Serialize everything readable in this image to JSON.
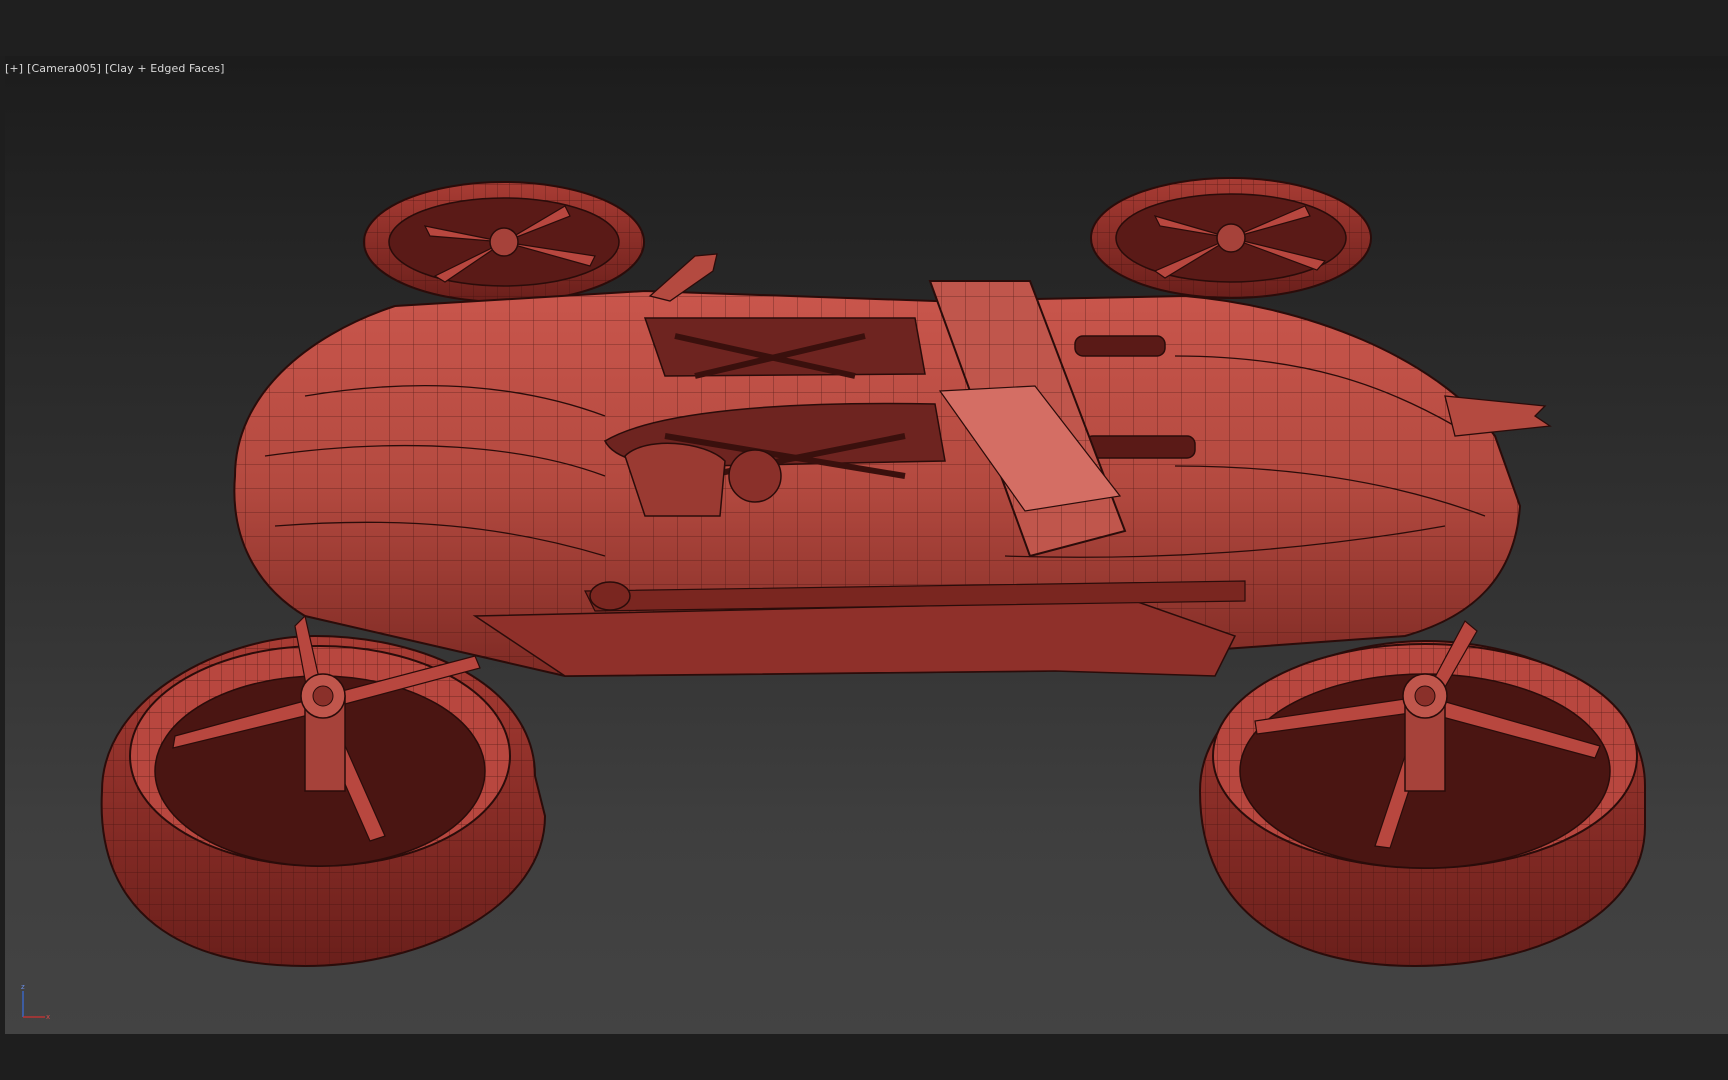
{
  "viewport": {
    "label": {
      "menu": "[+]",
      "camera": "[Camera005]",
      "shading": "[Clay + Edged Faces]"
    },
    "gizmo": {
      "z_label": "z",
      "x_label": "x"
    },
    "scene": {
      "object": "flying-car-model",
      "material_color": "#b8473f",
      "edge_color": "#2a0c0a"
    }
  }
}
